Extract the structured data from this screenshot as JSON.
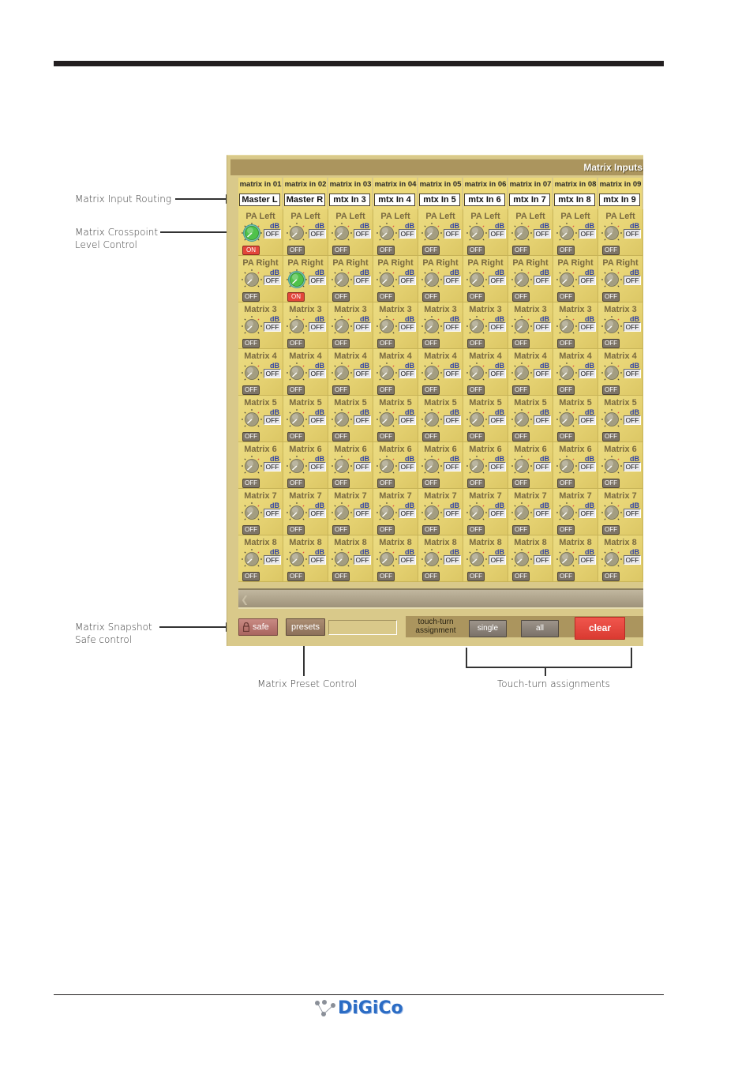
{
  "panel": {
    "title": "Matrix Inputs",
    "columns": [
      {
        "name": "matrix in 01",
        "routing": "Master L"
      },
      {
        "name": "matrix in 02",
        "routing": "Master R"
      },
      {
        "name": "matrix in 03",
        "routing": "mtx In 3"
      },
      {
        "name": "matrix in 04",
        "routing": "mtx In 4"
      },
      {
        "name": "matrix in 05",
        "routing": "mtx In 5"
      },
      {
        "name": "matrix in 06",
        "routing": "mtx In 6"
      },
      {
        "name": "matrix in 07",
        "routing": "mtx In 7"
      },
      {
        "name": "matrix in 08",
        "routing": "mtx In 8"
      },
      {
        "name": "matrix in 09",
        "routing": "mtx In 9"
      }
    ],
    "rows": [
      "PA Left",
      "PA Right",
      "Matrix 3",
      "Matrix 4",
      "Matrix 5",
      "Matrix 6",
      "Matrix 7",
      "Matrix 8"
    ],
    "db_unit": "dB",
    "db_value": "OFF",
    "on_label": "ON",
    "off_label": "OFF",
    "active_crosspoints": [
      [
        0,
        0
      ],
      [
        1,
        1
      ]
    ],
    "colors": {
      "on": "#e2463a",
      "knob_active": "#4fc24a",
      "knob_inactive": "#a39d80"
    },
    "bottom": {
      "safe_label": "safe",
      "presets_label": "presets",
      "preset_name": "",
      "touch_turn_label_1": "touch-turn",
      "touch_turn_label_2": "assignment",
      "single_label": "single",
      "all_label": "all",
      "clear_label": "clear"
    }
  },
  "callouts": {
    "input_routing": "Matrix Input Routing",
    "crosspoint_1": "Matrix Crosspoint",
    "crosspoint_2": "Level Control",
    "snapshot_1": "Matrix Snapshot",
    "snapshot_2": "Safe control",
    "preset_control": "Matrix Preset Control",
    "touch_turn": "Touch-turn assignments"
  },
  "footer": {
    "logo": "DiGiCo"
  }
}
